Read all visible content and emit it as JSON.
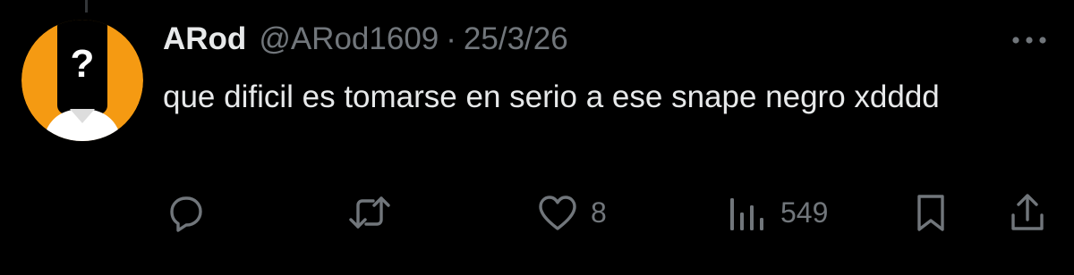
{
  "tweet": {
    "display_name": "ARod",
    "handle": "@ARod1609",
    "separator": "·",
    "date": "25/3/26",
    "text": "que dificil es tomarse en serio a ese snape negro xdddd"
  },
  "avatar": {
    "icon": "question-mark-silhouette",
    "symbol": "?",
    "background": "#f59a12"
  },
  "actions": {
    "reply": {
      "icon": "reply-icon"
    },
    "retweet": {
      "icon": "retweet-icon"
    },
    "like": {
      "icon": "heart-icon",
      "count": "8"
    },
    "views": {
      "icon": "views-icon",
      "count": "549"
    },
    "bookmark": {
      "icon": "bookmark-icon"
    },
    "share": {
      "icon": "share-icon"
    }
  },
  "colors": {
    "background": "#000000",
    "primary_text": "#e7e9ea",
    "secondary_text": "#71767b"
  }
}
